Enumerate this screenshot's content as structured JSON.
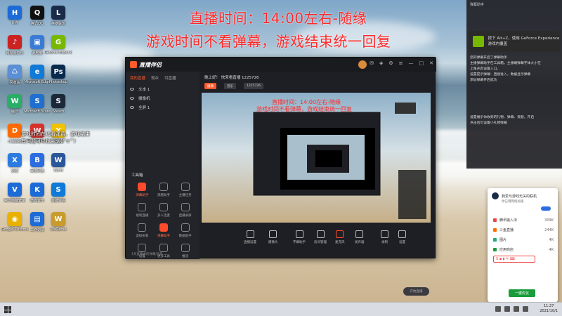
{
  "overlay": {
    "line1": "直播时间：14:00左右-随缘",
    "line2": "游戏时间不看弹幕，游戏结束统一回复",
    "small1": "游戏时间在线看弹幕，游戏结束",
    "small2": "有问题可以找我聊(^o^)"
  },
  "desktop_icons": [
    {
      "label": "Hi4",
      "color": "#1c6bd6",
      "glyph": "H"
    },
    {
      "label": "腾讯QQ",
      "color": "#111111",
      "glyph": "Q"
    },
    {
      "label": "英雄联盟",
      "color": "#1a2b4a",
      "glyph": "L"
    },
    {
      "label": "网易云音乐",
      "color": "#c22",
      "glyph": "♪"
    },
    {
      "label": "此电脑",
      "color": "#3a7bd5",
      "glyph": "▣"
    },
    {
      "label": "Geforce Experience",
      "color": "#76b900",
      "glyph": "G"
    },
    {
      "label": "回收站",
      "color": "#5b8fd6",
      "glyph": "♺"
    },
    {
      "label": "Microsoft Edge",
      "color": "#0f7ad8",
      "glyph": "e"
    },
    {
      "label": "Photoshop",
      "color": "#072a4d",
      "glyph": "Ps"
    },
    {
      "label": "微信",
      "color": "#2aae67",
      "glyph": "W"
    },
    {
      "label": "Microsoft Store",
      "color": "#1f6fd1",
      "glyph": "S"
    },
    {
      "label": "Steam",
      "color": "#1b2838",
      "glyph": "S"
    },
    {
      "label": "斗鱼直播",
      "color": "#ff6a00",
      "glyph": "D"
    },
    {
      "label": "WPS Office",
      "color": "#d9312b",
      "glyph": "W"
    },
    {
      "label": "YY语音",
      "color": "#f2c300",
      "glyph": "Y"
    },
    {
      "label": "迅雷",
      "color": "#2d7be0",
      "glyph": "X"
    },
    {
      "label": "百度网盘",
      "color": "#2b6de0",
      "glyph": "B"
    },
    {
      "label": "Word",
      "color": "#2b579a",
      "glyph": "W"
    },
    {
      "label": "腾讯电脑管家",
      "color": "#1c6bd6",
      "glyph": "V"
    },
    {
      "label": "酷狗音乐",
      "color": "#1c6bd6",
      "glyph": "K"
    },
    {
      "label": "直播伴侣",
      "color": "#0f7ad8",
      "glyph": "S"
    },
    {
      "label": "Google Chrome",
      "color": "#e8b100",
      "glyph": "◉"
    },
    {
      "label": "工作记录",
      "color": "#1c6bd6",
      "glyph": "▤"
    },
    {
      "label": "WeGame",
      "color": "#c99b2a",
      "glyph": "W"
    }
  ],
  "app": {
    "logo": "直播伴侣",
    "tabs": [
      "我的直播",
      "观众",
      "可直播"
    ],
    "sources": [
      "文本 1",
      "摄像机",
      "全屏 1"
    ],
    "stream_info": "晚上好！ 快来看直播 1225726",
    "info_tags": [
      "摄像",
      "音乐",
      "1225726"
    ],
    "tools_title": "工具箱",
    "tools": [
      {
        "label": "弹幕助手",
        "active": true
      },
      {
        "label": "观看助手",
        "active": false
      },
      {
        "label": "主播任务",
        "active": false
      },
      {
        "label": "福利直播",
        "active": false
      },
      {
        "label": "多人连麦",
        "active": false
      },
      {
        "label": "直播录屏",
        "active": false
      },
      {
        "label": "虚拟形象",
        "active": false
      },
      {
        "label": "弹幕助手",
        "active": true
      },
      {
        "label": "数据助手",
        "active": false
      },
      {
        "label": "设置",
        "active": false
      },
      {
        "label": "更多工具",
        "active": false
      },
      {
        "label": "推流",
        "active": false
      }
    ],
    "footer": "1条直播中的弹幕/消息",
    "bottom_buttons": [
      "直播设置",
      "摄像头",
      "字幕助手",
      "房间管理",
      "麦克风",
      "扬声器",
      "录制",
      "设置"
    ],
    "start_button": "开始直播"
  },
  "notification": {
    "header": "弹幕助手",
    "nvidia_title": "按下 Alt+Z，使用 GeForce Experience 游戏内覆盖",
    "lines": [
      "您的弹幕开启了弹幕助手",
      "主播弹幕助手在工具箱，主播端弹幕字体大小在",
      "上角开启设置入口。",
      "设置提示弹幕：直接进入，数据显示弹幕",
      "添加弹幕开启成功",
      "设置展示你收到的礼物、弹幕、贡献，开启",
      "点击后可设置小礼物弹幕"
    ]
  },
  "popup": {
    "title": "我爱与游戏无关的联机",
    "subtitle": "你已用网络加速",
    "rows": [
      {
        "name": "腾讯输入法",
        "value": "309K",
        "color": "#e44"
      },
      {
        "name": "斗鱼直播",
        "value": "244K",
        "color": "#ff6a00"
      },
      {
        "name": "图片",
        "value": "4K",
        "color": "#2a7"
      },
      {
        "name": "应用商店",
        "value": "4K",
        "color": "#1a9c3a"
      }
    ],
    "button": "一键优化"
  },
  "taskbar": {
    "time": "11:27",
    "date": "2021/10/1"
  }
}
